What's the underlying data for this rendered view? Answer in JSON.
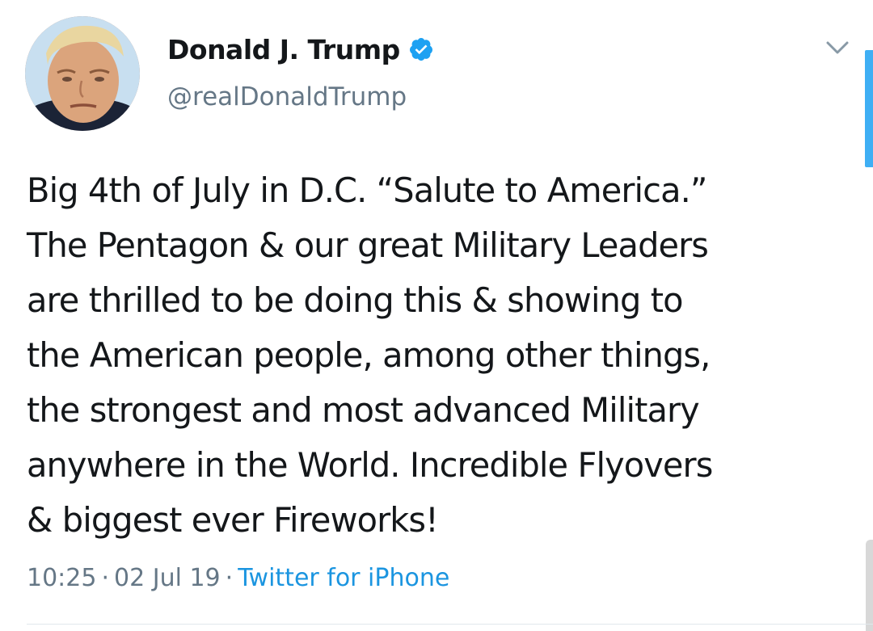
{
  "author": {
    "display_name": "Donald J. Trump",
    "handle": "@realDonaldTrump",
    "verified": true,
    "avatar_icon": "profile-photo"
  },
  "tweet": {
    "lines": [
      "Big 4th of July in D.C. “Salute to America.”",
      "The Pentagon & our great Military Leaders",
      "are thrilled to be doing this & showing to",
      "the American people, among other things,",
      "the strongest and most advanced Military",
      "anywhere in the World. Incredible Flyovers",
      "& biggest ever Fireworks!"
    ]
  },
  "meta": {
    "time": "10:25",
    "separator": "·",
    "date": "02 Jul 19",
    "source": "Twitter for iPhone"
  },
  "icons": {
    "verified": "verified-badge-icon",
    "menu": "chevron-down-icon"
  },
  "colors": {
    "text": "#14171a",
    "secondary": "#657786",
    "link": "#1b95e0",
    "verified": "#1da1f2"
  }
}
